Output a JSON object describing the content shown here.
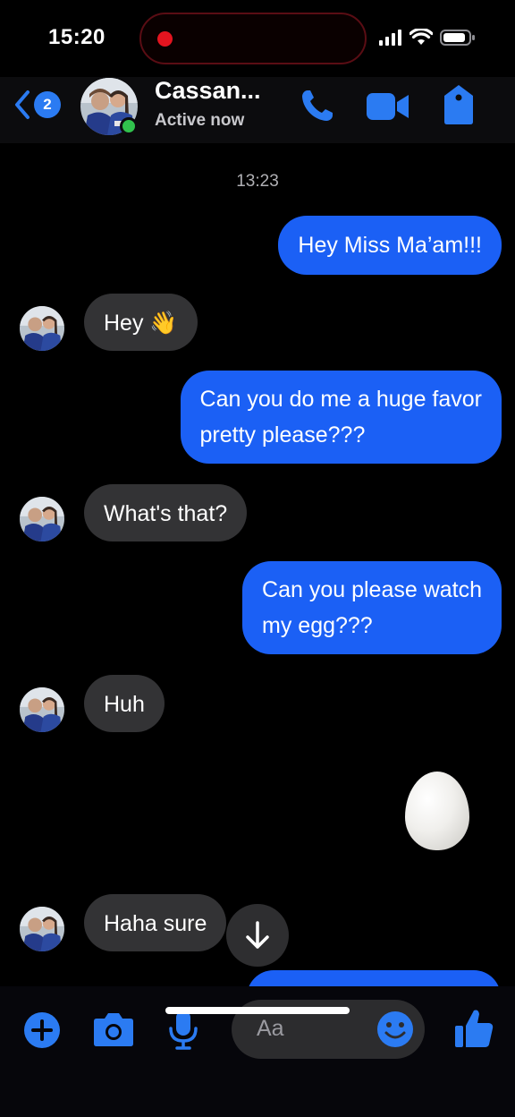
{
  "status_bar": {
    "time": "15:20"
  },
  "header": {
    "unread_count": "2",
    "contact_name": "Cassan...",
    "contact_status": "Active now"
  },
  "conversation": {
    "timestamp": "13:23",
    "messages": [
      {
        "direction": "outgoing",
        "text": "Hey Miss Ma’am!!!"
      },
      {
        "direction": "incoming",
        "text": "Hey 👋"
      },
      {
        "direction": "outgoing",
        "line1": "Can you do me a huge favor",
        "line2": "pretty please???"
      },
      {
        "direction": "incoming",
        "text": "What's that?"
      },
      {
        "direction": "outgoing",
        "line1": "Can you please watch",
        "line2": "my egg???"
      },
      {
        "direction": "incoming",
        "text": "Huh"
      },
      {
        "direction": "outgoing",
        "type": "image",
        "image": "egg"
      },
      {
        "direction": "incoming",
        "text": "Haha sure"
      }
    ]
  },
  "composer": {
    "placeholder": "Aa"
  },
  "colors": {
    "accent": "#1b60f5",
    "brand_icon": "#2b7bf2",
    "incoming_bubble": "#333335",
    "online": "#31c24d",
    "recording": "#e3141f"
  },
  "icons": [
    "back-chevron-icon",
    "phone-icon",
    "video-camera-icon",
    "tag-icon",
    "plus-icon",
    "camera-icon",
    "microphone-icon",
    "emoji-icon",
    "thumbs-up-icon",
    "arrow-down-icon"
  ]
}
